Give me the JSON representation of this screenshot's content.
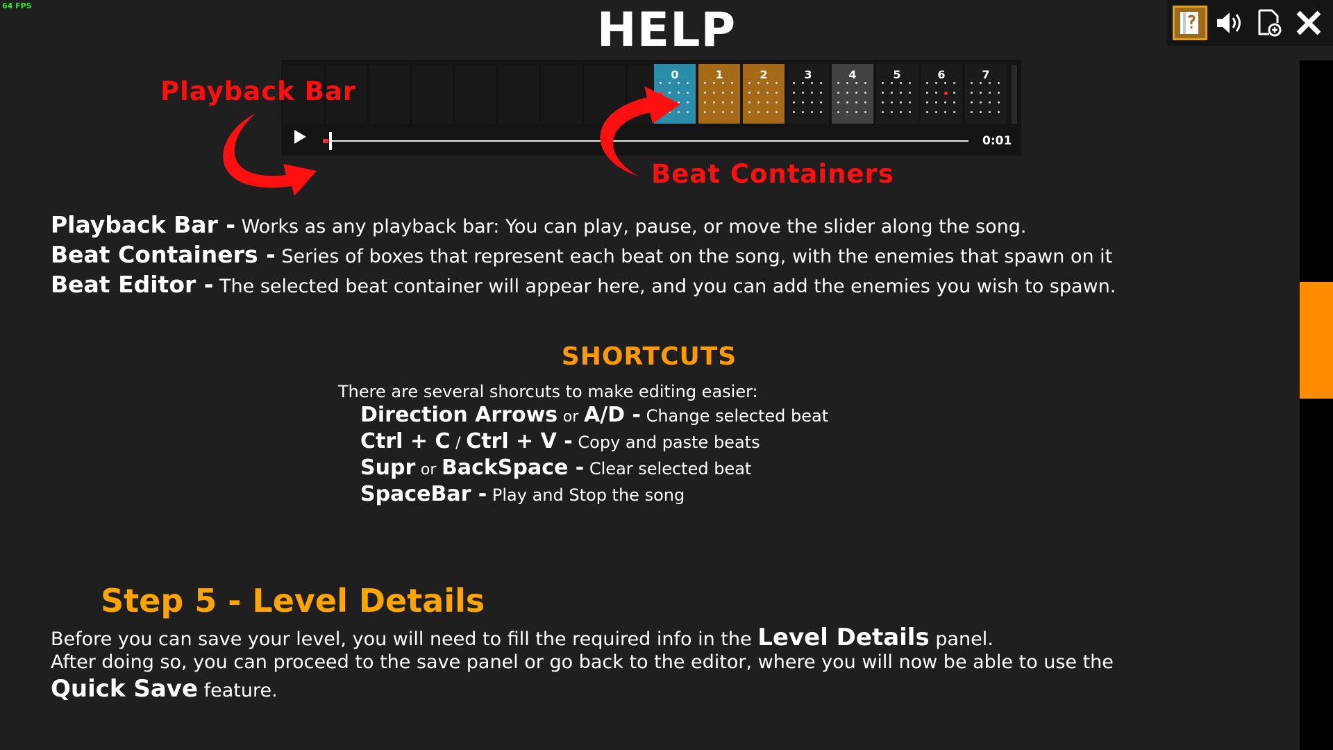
{
  "fps_label": "64 FPS",
  "title": "HELP",
  "toolbar": {
    "icons": [
      "help-book-icon",
      "speaker-icon",
      "new-file-icon",
      "close-icon"
    ],
    "accent": "#ffa500"
  },
  "scrollbar": {
    "thumb_color": "#ff8c00"
  },
  "timeline": {
    "beats": [
      {
        "label": "0",
        "color": "#2b8da8"
      },
      {
        "label": "1",
        "color": "#a56a17"
      },
      {
        "label": "2",
        "color": "#a56a17"
      },
      {
        "label": "3",
        "color": "#1b1b1b"
      },
      {
        "label": "4",
        "color": "#424242"
      },
      {
        "label": "5",
        "color": "#1b1b1b"
      },
      {
        "label": "6",
        "color": "#1b1b1b"
      },
      {
        "label": "7",
        "color": "#1b1b1b"
      }
    ],
    "time": "0:01"
  },
  "callouts": {
    "playback_bar": "Playback Bar",
    "beat_containers": "Beat Containers"
  },
  "descriptions": [
    {
      "term": "Playback Bar -",
      "text": "Works as any playback bar: You can play, pause, or move the slider along the song."
    },
    {
      "term": "Beat Containers -",
      "text": "Series of boxes that represent each beat on the song, with the enemies that spawn on it"
    },
    {
      "term": "Beat Editor -",
      "text": "The selected beat container will appear here, and you can add the enemies you wish to spawn."
    }
  ],
  "shortcuts": {
    "title": "SHORTCUTS",
    "intro": "There are several shorcuts to make editing easier:",
    "items": [
      {
        "key1": "Direction Arrows",
        "sep": "or",
        "key2": "A/D -",
        "desc": "Change selected beat"
      },
      {
        "key1": "Ctrl + C",
        "sep": "/",
        "key2": "Ctrl + V -",
        "desc": "Copy and paste beats"
      },
      {
        "key1": "Supr",
        "sep": "or",
        "key2": "BackSpace -",
        "desc": "Clear selected beat"
      },
      {
        "key1": "SpaceBar -",
        "sep": "",
        "key2": "",
        "desc": "Play and Stop the song"
      }
    ]
  },
  "step": {
    "title": "Step 5 - Level Details",
    "p1_before": "Before you can save your level, you will need to fill the required info in the",
    "p1_bold": "Level Details",
    "p1_after": "panel.",
    "p2": "After doing so, you can proceed to the save panel or go back to the editor, where you will now be able to use the",
    "p3_bold": "Quick Save",
    "p3_after": "feature."
  }
}
